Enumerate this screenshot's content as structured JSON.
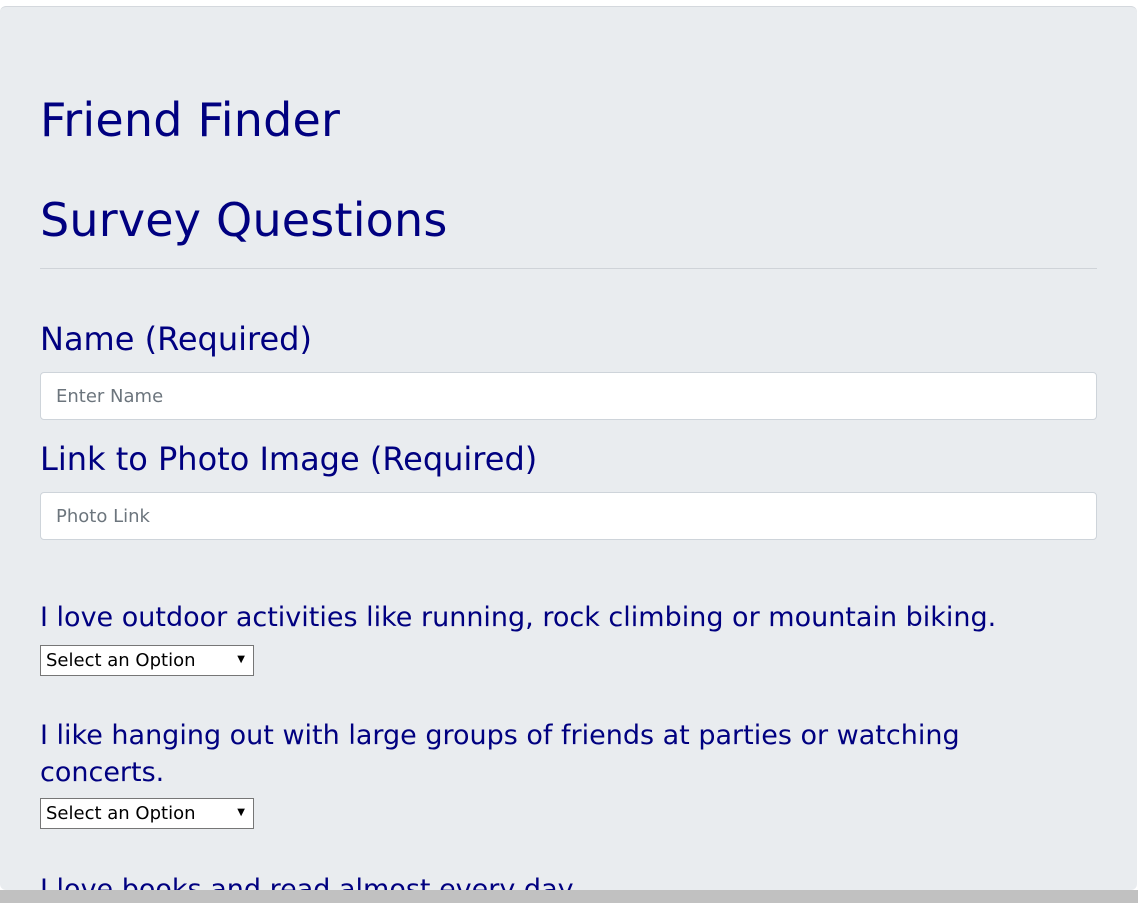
{
  "header": {
    "app_title": "Friend Finder",
    "section_title": "Survey Questions"
  },
  "form": {
    "name": {
      "label": "Name (Required)",
      "placeholder": "Enter Name",
      "value": ""
    },
    "photo": {
      "label": "Link to Photo Image (Required)",
      "placeholder": "Photo Link",
      "value": ""
    }
  },
  "questions": [
    {
      "text": "I love outdoor activities like running, rock climbing or mountain biking.",
      "selected": "Select an Option"
    },
    {
      "text": "I like hanging out with large groups of friends at parties or watching concerts.",
      "selected": "Select an Option"
    },
    {
      "text": "I love books and read almost every day."
    }
  ],
  "colors": {
    "heading": "#000080",
    "background": "#e9ecef",
    "divider": "#cfd3d8"
  },
  "icons": {
    "dropdown": "triangle-down-icon"
  }
}
